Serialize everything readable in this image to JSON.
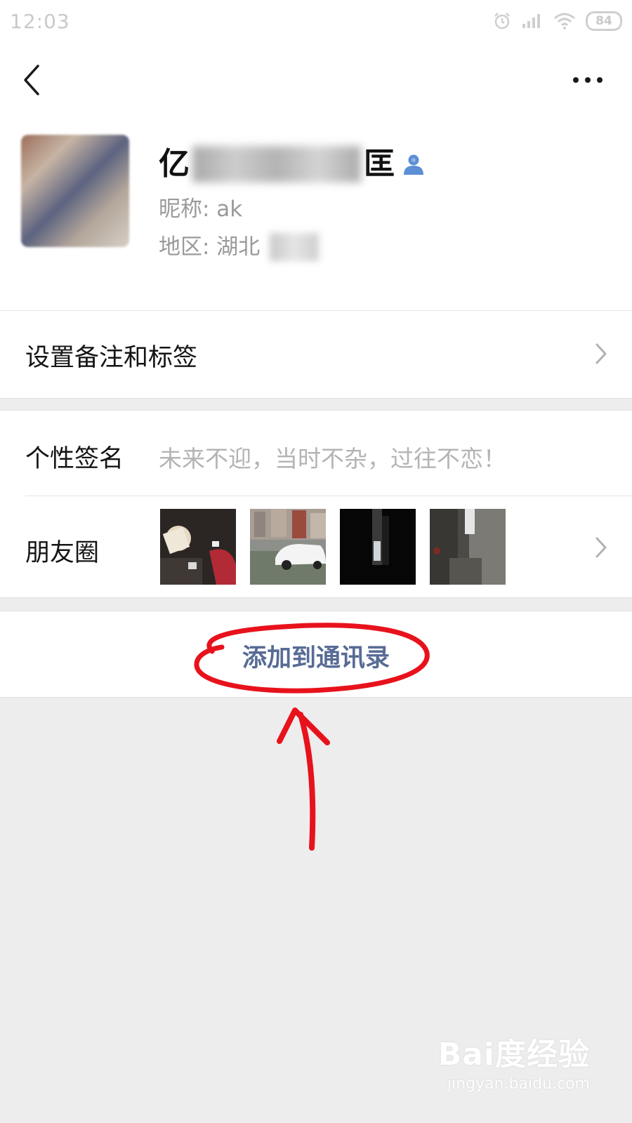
{
  "status_bar": {
    "time": "12:03",
    "battery": "84"
  },
  "profile": {
    "name_first": "亿",
    "name_last": "匡",
    "nickname": "昵称: ak",
    "region": "地区: 湖北"
  },
  "rows": {
    "remarks_label": "设置备注和标签",
    "signature_label": "个性签名",
    "signature_value": "未来不迎，当时不杂，过往不恋！",
    "moments_label": "朋友圈",
    "add_contact_label": "添加到通讯录"
  },
  "icons": {
    "back": "back-arrow-icon",
    "more": "more-dots-icon",
    "contact": "contact-person-icon",
    "chevron": "chevron-right-icon"
  },
  "colors": {
    "link": "#576b95",
    "annotation": "#e8121c",
    "background": "#ededed"
  },
  "watermark": {
    "logo": "Bai度经验",
    "url": "jingyan.baidu.com"
  }
}
